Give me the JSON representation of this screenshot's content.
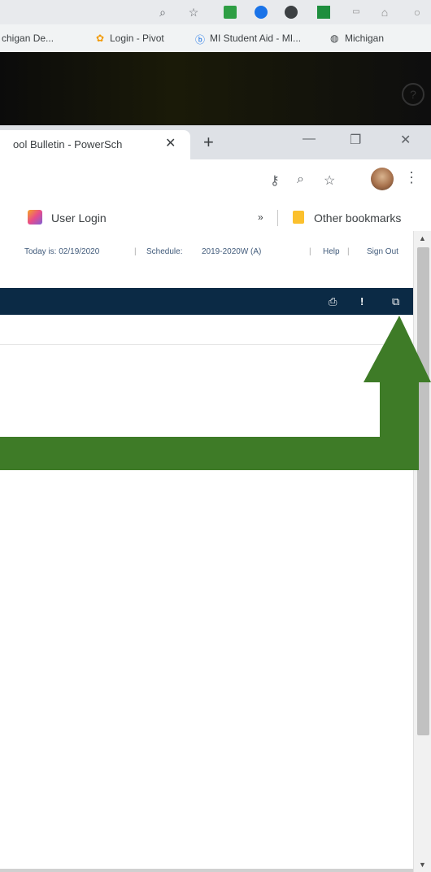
{
  "outer_bookmarks": {
    "items": [
      "chigan De...",
      "Login - Pivot",
      "MI Student Aid - MI...",
      "Michigan"
    ]
  },
  "tab": {
    "title": "ool Bulletin - PowerSch",
    "close": "✕",
    "new_tab": "+"
  },
  "window_controls": {
    "minimize": "—",
    "restore": "❐",
    "close": "✕"
  },
  "bookmarks": {
    "user_login": "User Login",
    "overflow": "»",
    "other": "Other bookmarks"
  },
  "infobar": {
    "today": "Today is: 02/19/2020",
    "schedule_label": "Schedule:",
    "schedule_value": "2019-2020W (A)",
    "help": "Help",
    "sign_out": "Sign Out",
    "sep": "|"
  },
  "icons": {
    "zoom": "⌕",
    "star": "☆",
    "key": "⚷",
    "kebab": "⋮",
    "print": "⎙",
    "alert": "!",
    "popout": "⧉",
    "help": "?"
  },
  "colors": {
    "arrow": "#3e7b27",
    "navbar": "#0b2a45"
  }
}
